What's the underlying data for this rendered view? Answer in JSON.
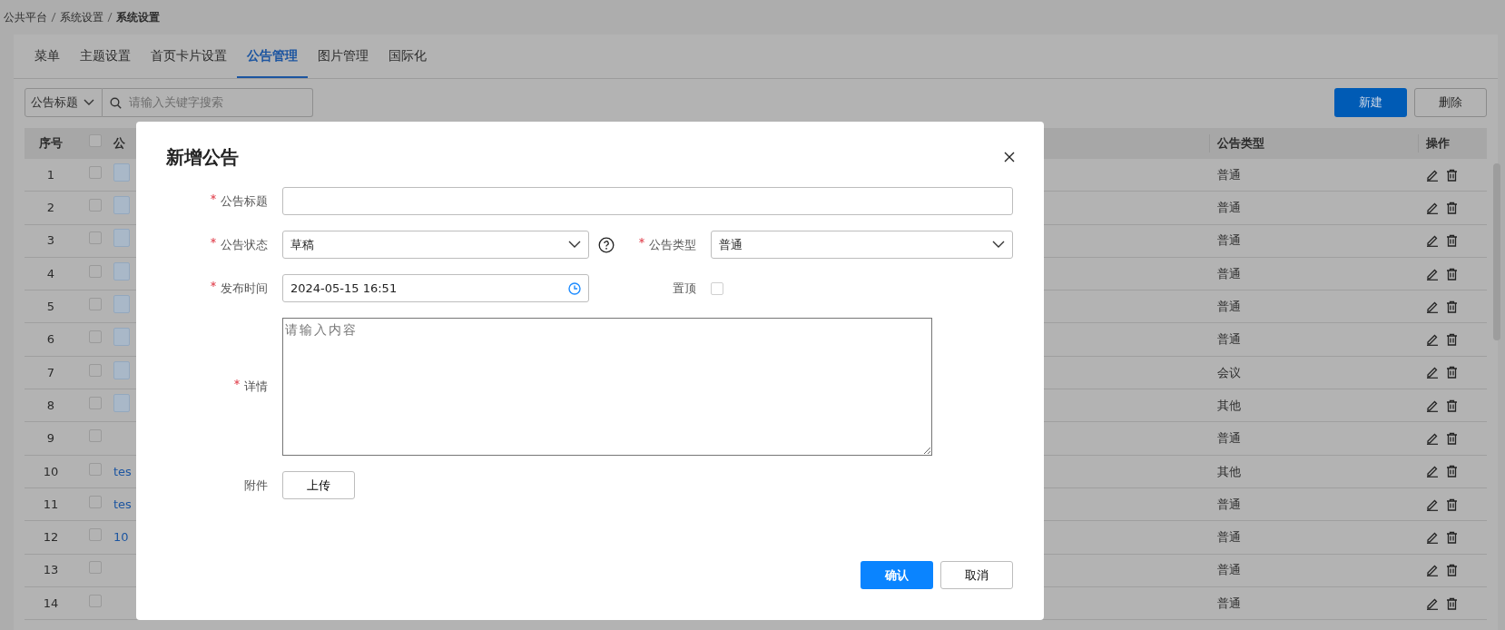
{
  "breadcrumb": [
    {
      "label": "公共平台",
      "current": false
    },
    {
      "label": "系统设置",
      "current": false
    },
    {
      "label": "系统设置",
      "current": true
    }
  ],
  "tabs": [
    {
      "label": "菜单",
      "selected": false
    },
    {
      "label": "主题设置",
      "selected": false
    },
    {
      "label": "首页卡片设置",
      "selected": false
    },
    {
      "label": "公告管理",
      "selected": true
    },
    {
      "label": "图片管理",
      "selected": false
    },
    {
      "label": "国际化",
      "selected": false
    }
  ],
  "filter": {
    "field": "公告标题",
    "search_placeholder": "请输入关键字搜索"
  },
  "toolbar": [
    {
      "label": "新建",
      "kind": "primary"
    },
    {
      "label": "删除",
      "kind": "secondary"
    }
  ],
  "table": {
    "columns": {
      "index": "序号",
      "title": "公",
      "type": "公告类型",
      "actions": "操作"
    },
    "header_checked": false,
    "rows": [
      {
        "index": "1",
        "checked": false,
        "pinned": true,
        "type": "普通"
      },
      {
        "index": "2",
        "checked": false,
        "pinned": true,
        "type": "普通"
      },
      {
        "index": "3",
        "checked": false,
        "pinned": true,
        "type": "普通"
      },
      {
        "index": "4",
        "checked": false,
        "pinned": true,
        "type": "普通"
      },
      {
        "index": "5",
        "checked": false,
        "pinned": true,
        "type": "普通"
      },
      {
        "index": "6",
        "checked": false,
        "pinned": true,
        "type": "普通"
      },
      {
        "index": "7",
        "checked": false,
        "pinned": true,
        "type": "会议"
      },
      {
        "index": "8",
        "checked": false,
        "pinned": true,
        "type": "其他"
      },
      {
        "index": "9",
        "checked": false,
        "pinned": false,
        "type": "普通"
      },
      {
        "index": "10",
        "checked": false,
        "pinned": false,
        "title": "tes",
        "type": "其他"
      },
      {
        "index": "11",
        "checked": false,
        "pinned": false,
        "title": "tes",
        "type": "普通"
      },
      {
        "index": "12",
        "checked": false,
        "pinned": false,
        "title": "10",
        "type": "普通"
      },
      {
        "index": "13",
        "checked": false,
        "pinned": false,
        "type": "普通"
      },
      {
        "index": "14",
        "checked": false,
        "pinned": false,
        "type": "普通"
      }
    ]
  },
  "modal": {
    "title": "新增公告",
    "rows": [
      [
        {
          "kind": "text",
          "label": "公告标题",
          "required": true
        }
      ],
      [
        {
          "kind": "select",
          "label": "公告状态",
          "required": true,
          "value": "草稿",
          "help": true
        },
        {
          "kind": "select",
          "label": "公告类型",
          "required": true,
          "value": "普通"
        }
      ],
      [
        {
          "kind": "datetime",
          "label": "发布时间",
          "required": true,
          "value": "2024-05-15 16:51"
        },
        {
          "kind": "checkbox",
          "label": "置顶",
          "required": false,
          "checked": false
        }
      ],
      [
        {
          "kind": "textarea",
          "label": "详情",
          "required": true,
          "placeholder": "请输入内容"
        }
      ],
      [
        {
          "kind": "upload",
          "label": "附件",
          "required": false,
          "button": "上传"
        }
      ]
    ],
    "buttons": [
      {
        "label": "确认",
        "kind": "primary"
      },
      {
        "label": "取消",
        "kind": "secondary"
      }
    ]
  }
}
